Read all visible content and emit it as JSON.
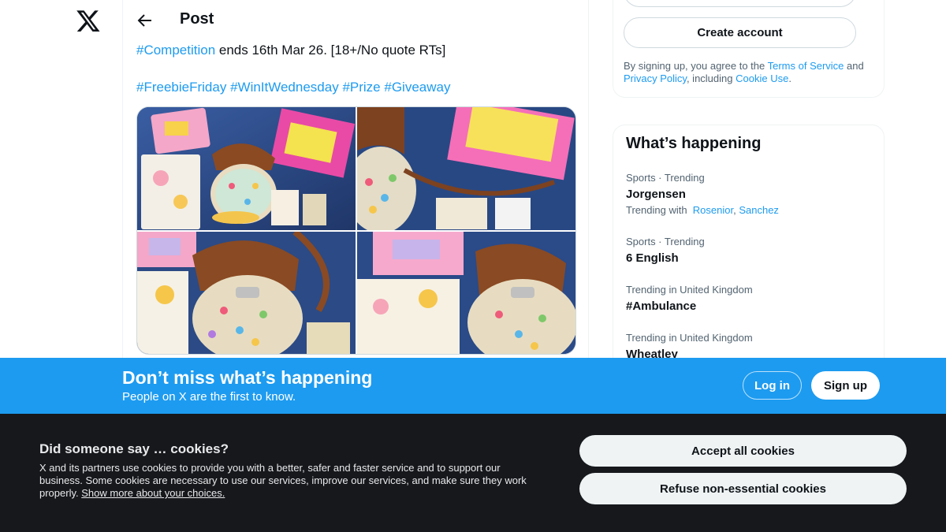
{
  "header": {
    "title": "Post"
  },
  "tweet": {
    "line1_hashtag": "#Competition",
    "line1_text": " ends 16th Mar 26. [18+/No quote RTs]",
    "hashtags": [
      "#FreebieFriday",
      "#WinItWednesday",
      "#Prize",
      "#Giveaway"
    ]
  },
  "media": {
    "images": [
      "giveaway-photo-1",
      "giveaway-photo-2",
      "giveaway-photo-3",
      "giveaway-photo-4"
    ]
  },
  "signup_card": {
    "create_account": "Create account",
    "terms_prefix": "By signing up, you agree to the ",
    "terms_link": "Terms of Service",
    "terms_and": " and ",
    "privacy_link": "Privacy Policy",
    "terms_including": ", including ",
    "cookie_link": "Cookie Use",
    "terms_end": "."
  },
  "trends": {
    "title": "What’s happening",
    "items": [
      {
        "meta": "Sports · Trending",
        "name": "Jorgensen",
        "with_label": "Trending with",
        "with": [
          "Rosenior",
          "Sanchez"
        ]
      },
      {
        "meta": "Sports · Trending",
        "name": "6 English"
      },
      {
        "meta": "Trending in United Kingdom",
        "name": "#Ambulance"
      },
      {
        "meta": "Trending in United Kingdom",
        "name": "Wheatley"
      }
    ]
  },
  "banner": {
    "title": "Don’t miss what’s happening",
    "subtitle": "People on X are the first to know.",
    "login": "Log in",
    "signup": "Sign up"
  },
  "cookies": {
    "title": "Did someone say … cookies?",
    "body": "X and its partners use cookies to provide you with a better, safer and faster service and to support our business. Some cookies are necessary to use our services, improve our services, and make sure they work properly. ",
    "link": "Show more about your choices.",
    "accept": "Accept all cookies",
    "refuse": "Refuse non-essential cookies"
  },
  "colors": {
    "accent": "#1d9bf0",
    "text": "#0f1419",
    "muted": "#536471",
    "cookie_bg": "#16181c"
  }
}
